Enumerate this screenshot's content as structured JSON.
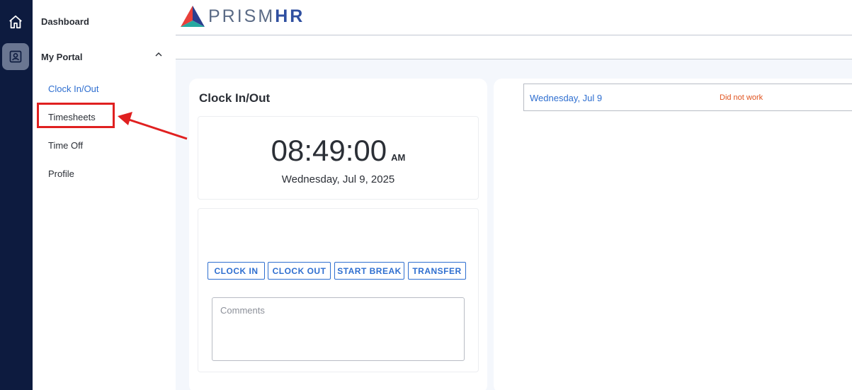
{
  "rail": {
    "items": [
      {
        "icon": "home-icon"
      },
      {
        "icon": "portal-icon",
        "active": true
      }
    ]
  },
  "sidebar": {
    "dashboard": "Dashboard",
    "my_portal": "My Portal",
    "items": [
      {
        "label": "Clock In/Out",
        "active": true
      },
      {
        "label": "Timesheets"
      },
      {
        "label": "Time Off"
      },
      {
        "label": "Profile"
      }
    ]
  },
  "header": {
    "logo_light": "PRISM",
    "logo_bold": "HR"
  },
  "clock": {
    "title": "Clock In/Out",
    "time": "08:49:00",
    "ampm": "AM",
    "date": "Wednesday, Jul 9, 2025",
    "buttons": [
      "CLOCK IN",
      "CLOCK OUT",
      "START BREAK",
      "TRANSFER"
    ],
    "comments_placeholder": "Comments"
  },
  "timesheet": {
    "rows": [
      {
        "date": "Wednesday, Jul 9",
        "status": "Did not work"
      }
    ]
  },
  "colors": {
    "accent": "#2f6fd0",
    "rail": "#0d1b3f",
    "annotation": "#e02020",
    "status": "#e0531f"
  }
}
